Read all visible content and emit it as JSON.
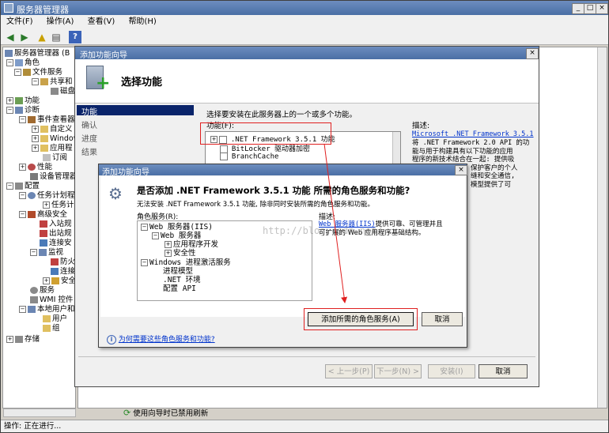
{
  "main_window": {
    "title": "服务器管理器",
    "menu": [
      "文件(F)",
      "操作(A)",
      "查看(V)",
      "帮助(H)"
    ],
    "tree": {
      "root": "服务器管理器 (B",
      "roles": "角色",
      "file_services": "文件服务",
      "share": "共享和",
      "disk": "磁盘",
      "features": "功能",
      "diagnostics": "诊断",
      "event_viewer": "事件查看器",
      "custom": "自定义",
      "windows": "Window",
      "apps": "应用程",
      "subscriptions": "订阅",
      "performance": "性能",
      "device_manager": "设备管理器",
      "config": "配置",
      "task_scheduler": "任务计划程",
      "task_sub": "任务计",
      "firewall": "高级安全",
      "inbound": "入站规",
      "outbound": "出站规",
      "conn_sec": "连接安",
      "monitor": "监视",
      "fw_sub": "防火",
      "conn_sub": "连接",
      "sec_sub": "安全",
      "services": "服务",
      "wmi": "WMI 控件",
      "local_users": "本地用户和",
      "users": "用户",
      "groups": "组",
      "storage": "存储"
    },
    "status_refresh": "使用向导时已禁用刷新",
    "status_bar": "操作:  正在进行..."
  },
  "wizard": {
    "title": "添加功能向导",
    "heading": "选择功能",
    "nav": [
      "功能",
      "确认",
      "进度",
      "结果"
    ],
    "instruction": "选择要安装在此服务器上的一个或多个功能。",
    "features_label": "功能(F):",
    "features": [
      ".NET Framework 3.5.1 功能",
      "BitLocker 驱动器加密",
      "BranchCache"
    ],
    "desc_label": "描述:",
    "desc_link": "Microsoft .NET Framework 3.5.1",
    "desc_lines": [
      "将 .NET Framework 2.0 API 的功",
      "能与用于构建具有以下功能的应用",
      "程序的新技术结合在一起: 提供吸",
      "保护客户的个人",
      "缝和安全通信,",
      "模型提供了可"
    ],
    "buttons": {
      "prev": "< 上一步(P)",
      "next": "下一步(N) >",
      "install": "安装(I)",
      "cancel": "取消"
    }
  },
  "dialog": {
    "title": "添加功能向导",
    "question": "是否添加 .NET Framework 3.5.1 功能 所需的角色服务和功能?",
    "subtext": "无法安装 .NET Framework 3.5.1 功能, 除非同时安装所需的角色服务和功能。",
    "roles_label": "角色服务(R):",
    "desc_label": "描述:",
    "desc_link": "Web 服务器(IIS)",
    "desc_text_1": "提供可靠、可管理并且",
    "desc_text_2": "可扩展的 Web 应用程序基础结构。",
    "tree": [
      "Web 服务器(IIS)",
      "Web 服务器",
      "应用程序开发",
      "安全性",
      "Windows 进程激活服务",
      "进程模型",
      ".NET 环境",
      "配置 API"
    ],
    "add_button": "添加所需的角色服务(A)",
    "cancel_button": "取消",
    "help_link": "为何需要这些角色服务和功能?",
    "watermark": "http://blog.csdn.net/"
  },
  "colors": {
    "highlight_red": "#e02020",
    "selection_blue": "#0a246a",
    "link_blue": "#0033cc"
  }
}
